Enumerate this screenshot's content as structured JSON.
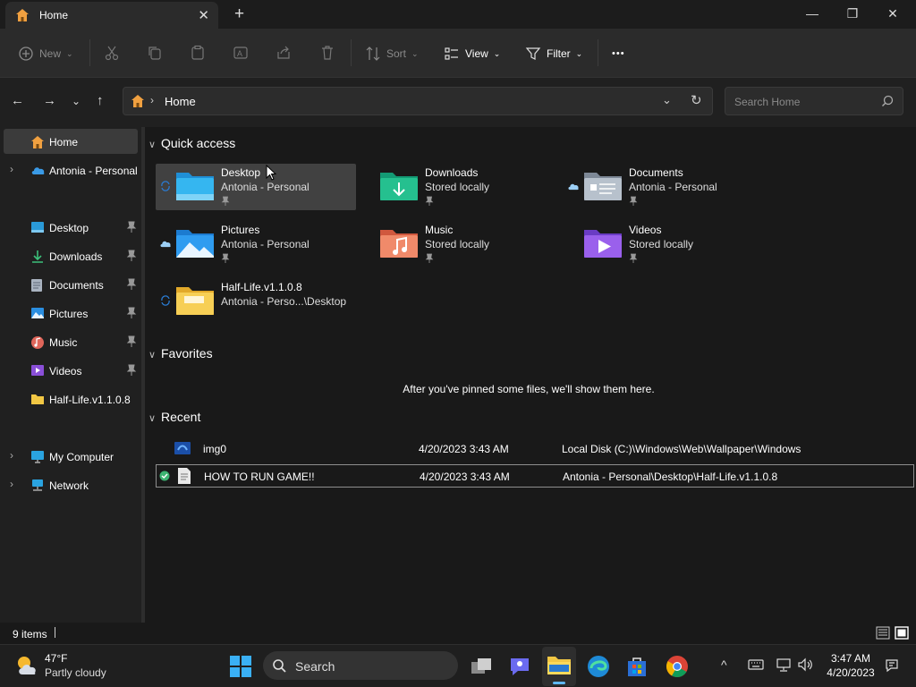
{
  "window": {
    "tab_title": "Home",
    "icons": {
      "tab": "home-icon",
      "close_tab": "close-icon",
      "new_tab": "plus-icon"
    }
  },
  "toolbar": {
    "new_label": "New",
    "sort_label": "Sort",
    "view_label": "View",
    "filter_label": "Filter",
    "more_label": "•••"
  },
  "address": {
    "crumb": "Home",
    "search_placeholder": "Search Home"
  },
  "sidebar": {
    "home": "Home",
    "onedrive": "Antonia - Personal",
    "items": [
      {
        "label": "Desktop",
        "icon": "desktop-icon"
      },
      {
        "label": "Downloads",
        "icon": "download-icon"
      },
      {
        "label": "Documents",
        "icon": "documents-icon"
      },
      {
        "label": "Pictures",
        "icon": "pictures-icon"
      },
      {
        "label": "Music",
        "icon": "music-icon"
      },
      {
        "label": "Videos",
        "icon": "videos-icon"
      },
      {
        "label": "Half-Life.v1.1.0.8",
        "icon": "folder-icon"
      }
    ],
    "my_computer": "My Computer",
    "network": "Network"
  },
  "quick_access": {
    "title": "Quick access",
    "items": [
      {
        "name": "Desktop",
        "sub": "Antonia - Personal"
      },
      {
        "name": "Downloads",
        "sub": "Stored locally"
      },
      {
        "name": "Documents",
        "sub": "Antonia - Personal"
      },
      {
        "name": "Pictures",
        "sub": "Antonia - Personal"
      },
      {
        "name": "Music",
        "sub": "Stored locally"
      },
      {
        "name": "Videos",
        "sub": "Stored locally"
      },
      {
        "name": "Half-Life.v1.1.0.8",
        "sub": "Antonia - Perso...\\Desktop"
      }
    ]
  },
  "favorites": {
    "title": "Favorites",
    "empty_message": "After you've pinned some files, we'll show them here."
  },
  "recent": {
    "title": "Recent",
    "rows": [
      {
        "name": "img0",
        "date": "4/20/2023 3:43 AM",
        "location": "Local Disk (C:)\\Windows\\Web\\Wallpaper\\Windows"
      },
      {
        "name": "HOW TO RUN GAME!!",
        "date": "4/20/2023 3:43 AM",
        "location": "Antonia - Personal\\Desktop\\Half-Life.v1.1.0.8"
      }
    ]
  },
  "status": {
    "count": "9 items"
  },
  "taskbar": {
    "weather_temp": "47°F",
    "weather_desc": "Partly cloudy",
    "search_label": "Search",
    "time": "3:47 AM",
    "date": "4/20/2023"
  }
}
